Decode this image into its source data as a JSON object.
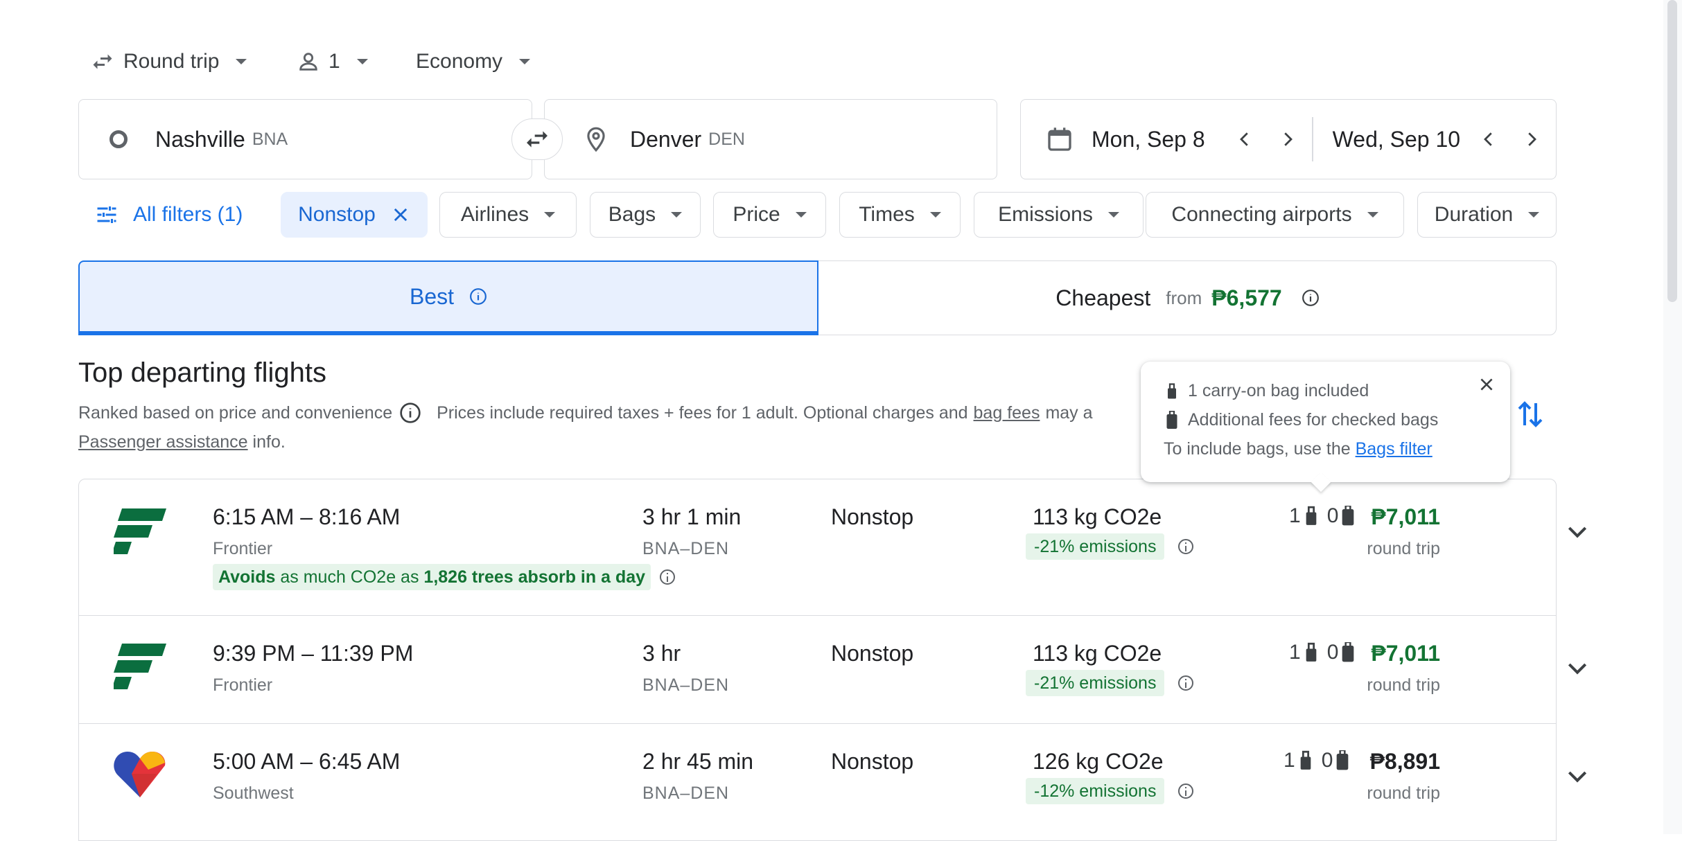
{
  "trip": {
    "type": "Round trip",
    "passengers": "1",
    "cabin": "Economy"
  },
  "search": {
    "origin_city": "Nashville",
    "origin_code": "BNA",
    "destination_city": "Denver",
    "destination_code": "DEN",
    "depart_date": "Mon, Sep 8",
    "return_date": "Wed, Sep 10"
  },
  "filters": {
    "all_filters": "All filters (1)",
    "active": "Nonstop",
    "chips": [
      "Airlines",
      "Bags",
      "Price",
      "Times",
      "Emissions",
      "Connecting airports",
      "Duration"
    ]
  },
  "tabs": {
    "best": "Best",
    "cheapest": "Cheapest",
    "cheapest_from": "from",
    "cheapest_price": "₱6,577"
  },
  "results": {
    "heading": "Top departing flights",
    "ranked": "Ranked based on price and convenience",
    "prices_note": "Prices include required taxes + fees for 1 adult. Optional charges and",
    "bag_fees": "bag fees",
    "may_apply": "may a",
    "passenger_link": "Passenger assistance",
    "info_suffix": "info."
  },
  "tooltip": {
    "carry_on": "1 carry-on bag included",
    "checked": "Additional fees for checked bags",
    "include_text": "To include bags, use the",
    "bags_filter": "Bags filter"
  },
  "flights": [
    {
      "times": "6:15 AM – 8:16 AM",
      "airline": "Frontier",
      "duration": "3 hr 1 min",
      "route": "BNA–DEN",
      "stops": "Nonstop",
      "co2": "113 kg CO2e",
      "emissions": "-21% emissions",
      "carry_on": "1",
      "checked": "0",
      "price": "₱7,011",
      "trip_type": "round trip",
      "avoids": "Avoids",
      "avoids_mid": "as much CO2e as",
      "avoids_trees": "1,826 trees absorb in a day"
    },
    {
      "times": "9:39 PM – 11:39 PM",
      "airline": "Frontier",
      "duration": "3 hr",
      "route": "BNA–DEN",
      "stops": "Nonstop",
      "co2": "113 kg CO2e",
      "emissions": "-21% emissions",
      "carry_on": "1",
      "checked": "0",
      "price": "₱7,011",
      "trip_type": "round trip"
    },
    {
      "times": "5:00 AM – 6:45 AM",
      "airline": "Southwest",
      "duration": "2 hr 45 min",
      "route": "BNA–DEN",
      "stops": "Nonstop",
      "co2": "126 kg CO2e",
      "emissions": "-12% emissions",
      "carry_on": "1",
      "checked": "0",
      "price": "₱8,891",
      "trip_type": "round trip"
    }
  ],
  "colors": {
    "accent": "#1a73e8",
    "price_green": "#137333",
    "best_tab_bg": "#e8f0fe",
    "frontier_green": "#0b6e3f"
  },
  "icons": [
    "swap-arrows-icon",
    "person-icon",
    "origin-circle-icon",
    "swap-icon",
    "location-pin-icon",
    "calendar-icon",
    "chevron-left-icon",
    "chevron-right-icon",
    "filter-sliders-icon",
    "close-icon",
    "info-icon",
    "sort-icon",
    "carry-on-bag-icon",
    "checked-bag-icon",
    "chevron-down-icon",
    "frontier-logo",
    "southwest-logo"
  ]
}
